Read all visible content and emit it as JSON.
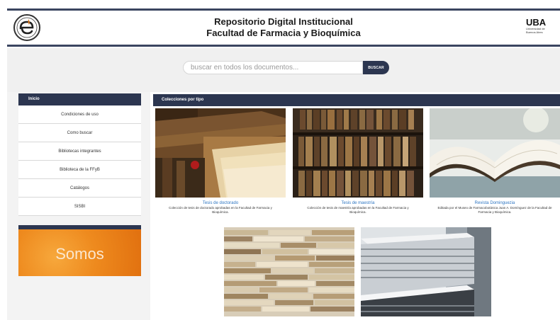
{
  "header": {
    "title_line1": "Repositorio Digital Institucional",
    "title_line2": "Facultad de Farmacia y Bioquímica",
    "uba_mark": "UBA",
    "uba_sub1": "Universidad de",
    "uba_sub2": "Buenos Aires"
  },
  "search": {
    "placeholder": "buscar en todos los documentos...",
    "button_label": "BUSCAR"
  },
  "nav": {
    "heading": "Inicio",
    "items": [
      "Condiciones de uso",
      "Como buscar",
      "Bibliotecas integrantes",
      "Biblioteca de la FFyB",
      "Catálogos",
      "SISBI"
    ]
  },
  "banner": {
    "label": "Somos"
  },
  "main": {
    "heading": "Colecciones por tipo",
    "cards": [
      {
        "title": "Tesis de doctorado",
        "description": "Colección de tesis de doctorado aprobadas en la Facultad de Farmacia y Bioquímica."
      },
      {
        "title": "Tesis de maestría",
        "description": "Colección de tesis de maestría aprobadas en la Facultad de Farmacia y Bioquímica."
      },
      {
        "title": "Revista Dominguezia",
        "description": "Editada por el Museo de Farmacobotánica Juan A. Domínguez de la Facultad de Farmacia y Bioquímica."
      }
    ]
  },
  "colors": {
    "navy": "#2c3650",
    "link_blue": "#2e76c2",
    "banner_orange": "#ee8a1e"
  }
}
